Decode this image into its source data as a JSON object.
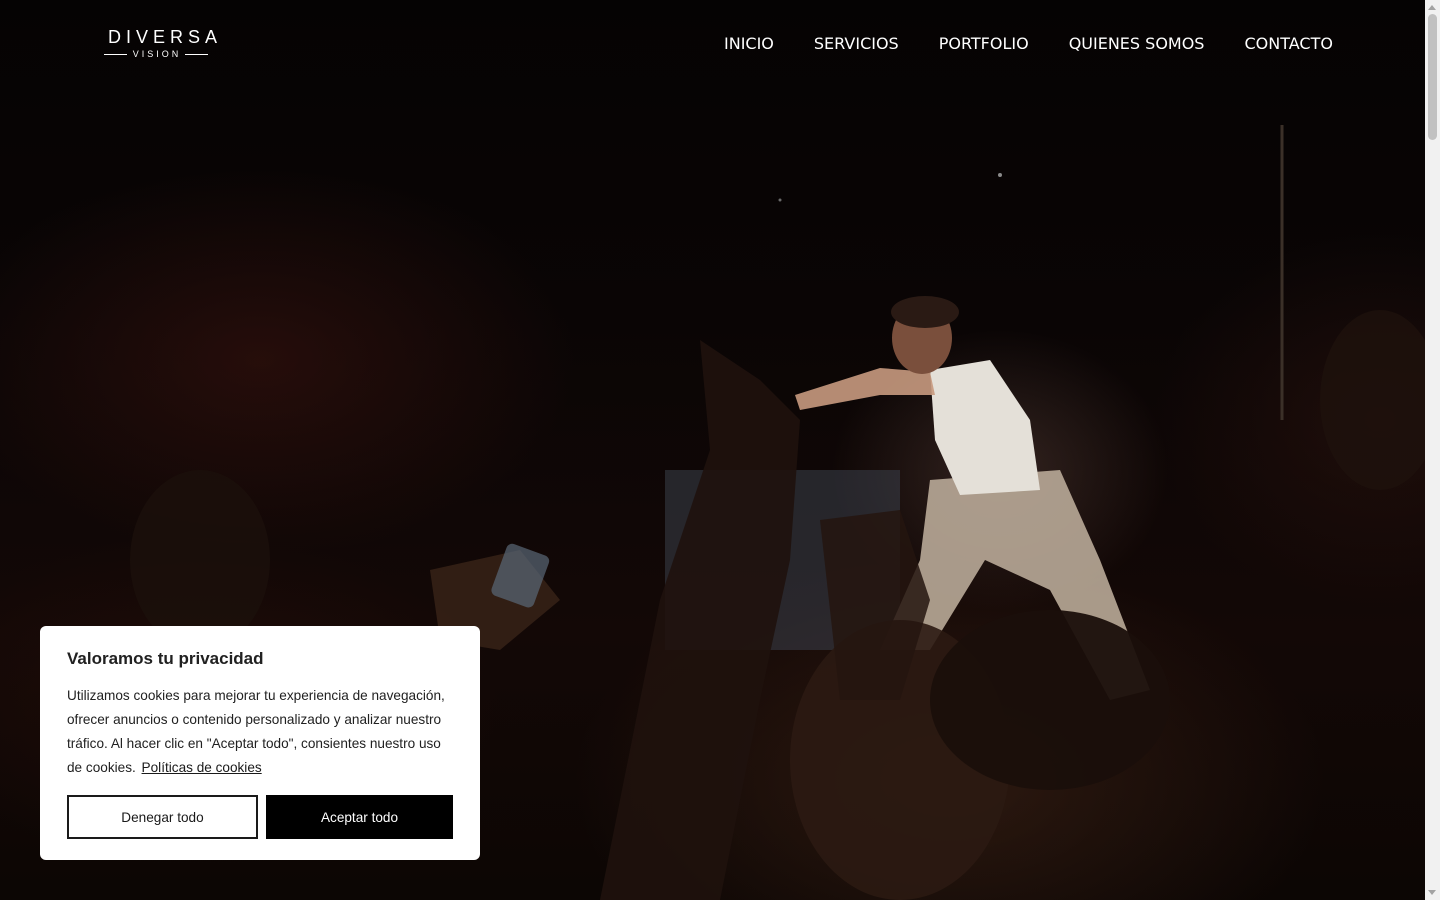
{
  "header": {
    "logo": {
      "top": "DIVERSA",
      "bottom": "VISION"
    },
    "nav": [
      {
        "label": "INICIO"
      },
      {
        "label": "SERVICIOS"
      },
      {
        "label": "PORTFOLIO"
      },
      {
        "label": "QUIENES SOMOS"
      },
      {
        "label": "CONTACTO"
      }
    ]
  },
  "hero": {
    "image": "concert-performer-photo"
  },
  "cookie_banner": {
    "title": "Valoramos tu privacidad",
    "text": "Utilizamos cookies para mejorar tu experiencia de navegación, ofrecer anuncios o contenido personalizado y analizar nuestro tráfico. Al hacer clic en \"Aceptar todo\", consientes nuestro uso de cookies.",
    "policy_link": "Políticas de cookies",
    "deny_label": "Denegar todo",
    "accept_label": "Aceptar todo"
  },
  "colors": {
    "background": "#000000",
    "nav_text": "#ffffff",
    "banner_bg": "#ffffff",
    "accept_bg": "#000000"
  }
}
